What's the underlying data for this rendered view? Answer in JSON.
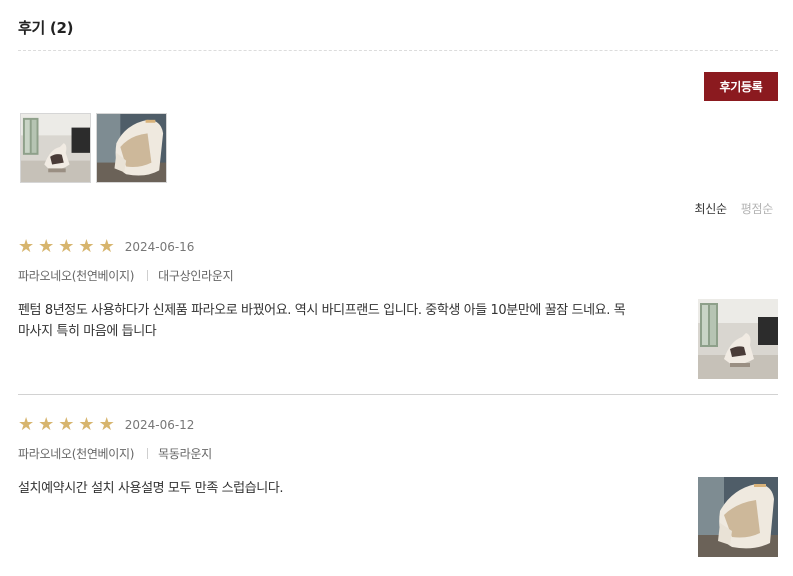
{
  "header": {
    "title": "후기 (2)"
  },
  "toolbar": {
    "register_label": "후기등록"
  },
  "gallery": [
    {
      "icon": "massage-chair-living-room-photo"
    },
    {
      "icon": "massage-chair-closeup-photo"
    }
  ],
  "sort": {
    "options": [
      "최신순",
      "평점순"
    ],
    "active": "최신순"
  },
  "colors": {
    "accent": "#8b1a1f",
    "star": "#d7b56e"
  },
  "reviews": [
    {
      "rating": 5,
      "date": "2024-06-16",
      "product": "파라오네오(천연베이지)",
      "store": "대구상인라운지",
      "text": "펜텀 8년정도 사용하다가 신제품 파라오로 바꿨어요. 역시 바디프랜드 입니다. 중학생 아들 10분만에 꿀잠 드네요. 목 마사지 특히 마음에 듭니다"
    },
    {
      "rating": 5,
      "date": "2024-06-12",
      "product": "파라오네오(천연베이지)",
      "store": "목동라운지",
      "text": "설치예약시간 설치 사용설명 모두 만족 스럽습니다."
    }
  ]
}
